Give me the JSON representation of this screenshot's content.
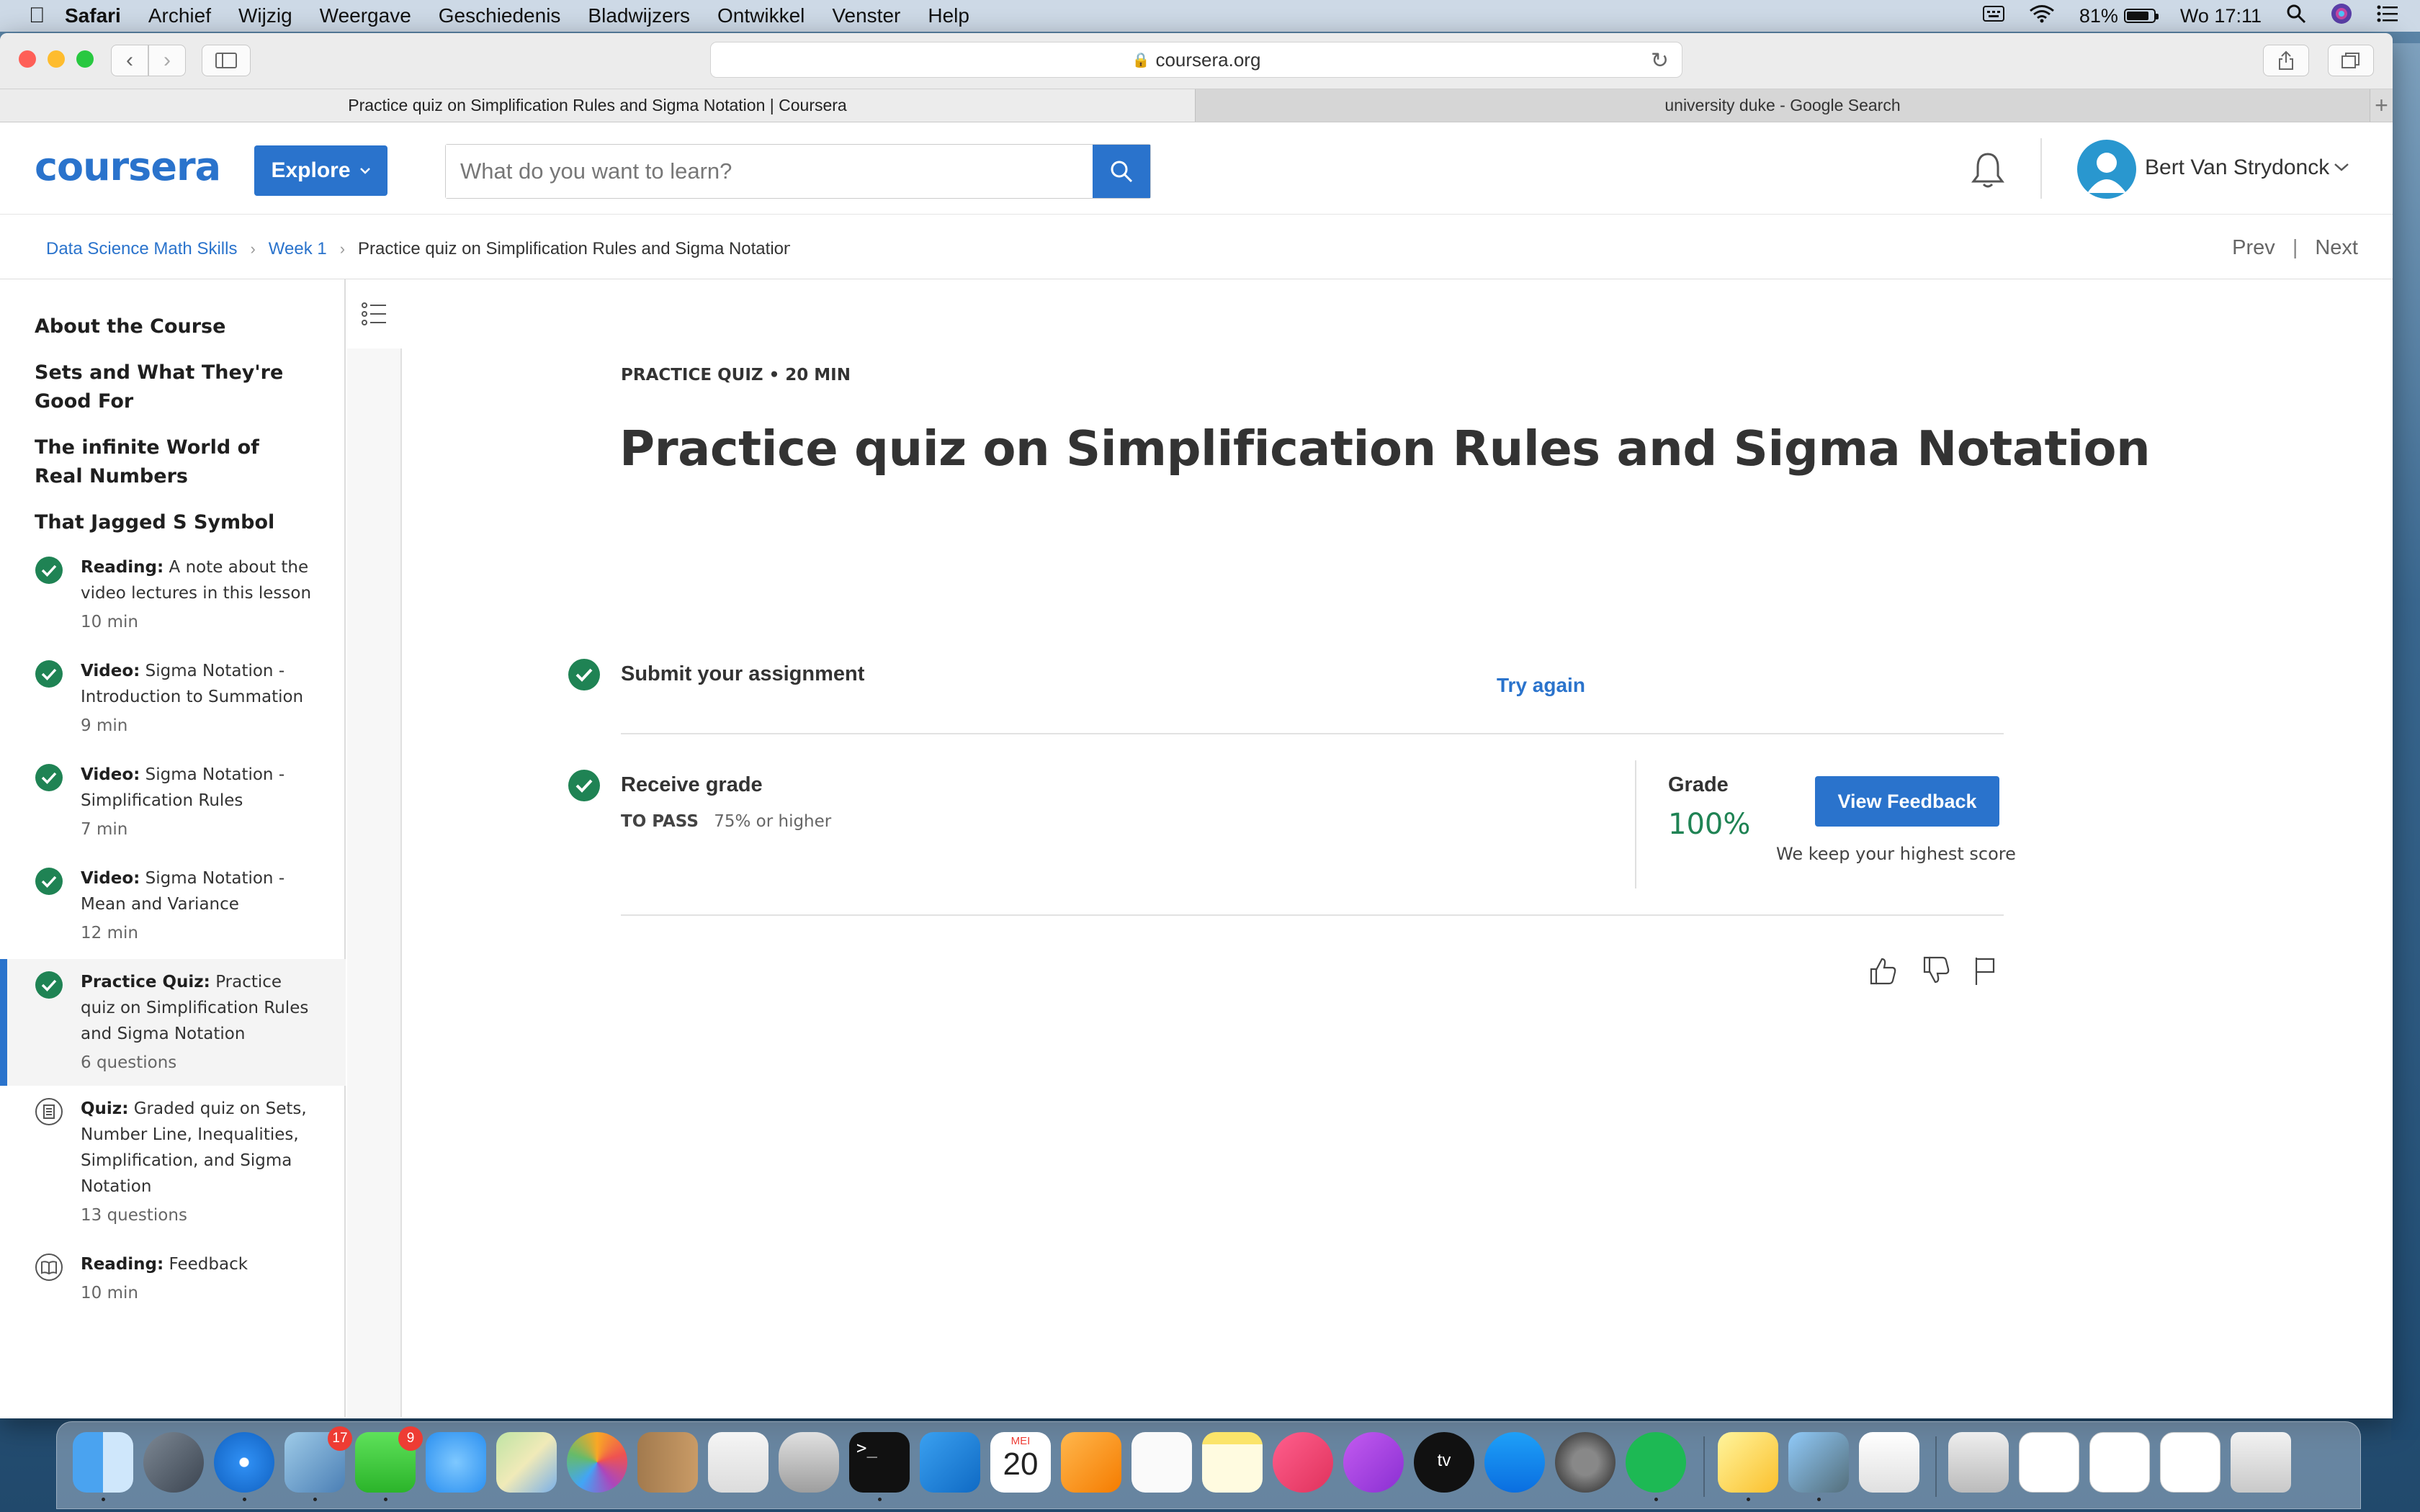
{
  "menubar": {
    "app": "Safari",
    "items": [
      "Archief",
      "Wijzig",
      "Weergave",
      "Geschiedenis",
      "Bladwijzers",
      "Ontwikkel",
      "Venster",
      "Help"
    ],
    "battery": "81%",
    "clock": "Wo 17:11"
  },
  "browser": {
    "url": "coursera.org",
    "tabs": [
      {
        "title": "Practice quiz on Simplification Rules and Sigma Notation | Coursera",
        "active": true
      },
      {
        "title": "university duke - Google Search",
        "active": false
      }
    ],
    "new_tab": "+"
  },
  "header": {
    "logo": "coursera",
    "explore_label": "Explore",
    "search_placeholder": "What do you want to learn?",
    "username": "Bert Van Strydonck"
  },
  "breadcrumb": {
    "course": "Data Science Math Skills",
    "week": "Week 1",
    "current": "Practice quiz on Simplification Rules and Sigma Notation",
    "prev": "Prev",
    "next": "Next"
  },
  "sidebar": {
    "modules": [
      "About the Course",
      "Sets and What They're Good For",
      "The infinite World of Real Numbers",
      "That Jagged S Symbol"
    ],
    "items": [
      {
        "type": "Reading:",
        "title": "A note about the video lectures in this lesson",
        "meta": "10 min",
        "status": "completed"
      },
      {
        "type": "Video:",
        "title": "Sigma Notation - Introduction to Summation",
        "meta": "9 min",
        "status": "completed"
      },
      {
        "type": "Video:",
        "title": "Sigma Notation - Simplification Rules",
        "meta": "7 min",
        "status": "completed"
      },
      {
        "type": "Video:",
        "title": "Sigma Notation - Mean and Variance",
        "meta": "12 min",
        "status": "completed"
      },
      {
        "type": "Practice Quiz:",
        "title": "Practice quiz on Simplification Rules and Sigma Notation",
        "meta": "6 questions",
        "status": "completed"
      },
      {
        "type": "Quiz:",
        "title": "Graded quiz on Sets, Number Line, Inequalities, Simplification, and Sigma Notation",
        "meta": "13 questions",
        "status": "quiz"
      },
      {
        "type": "Reading:",
        "title": "Feedback",
        "meta": "10 min",
        "status": "reading"
      }
    ]
  },
  "main": {
    "eyebrow": "PRACTICE QUIZ • 20 MIN",
    "title": "Practice quiz on Simplification Rules and Sigma Notation",
    "step1": "Submit your assignment",
    "try_again": "Try again",
    "step2": "Receive grade",
    "to_pass_label": "TO PASS",
    "to_pass_value": "75% or higher",
    "grade_label": "Grade",
    "grade_value": "100%",
    "view_feedback": "View Feedback",
    "keep_note": "We keep your highest score"
  },
  "dock": {
    "mail_badge": "17",
    "facetime_badge": "9",
    "calendar_month": "MEI",
    "calendar_day": "20",
    "tv_label": "tv"
  },
  "colors": {
    "accent": "#2a73cc",
    "success": "#1f8354"
  }
}
